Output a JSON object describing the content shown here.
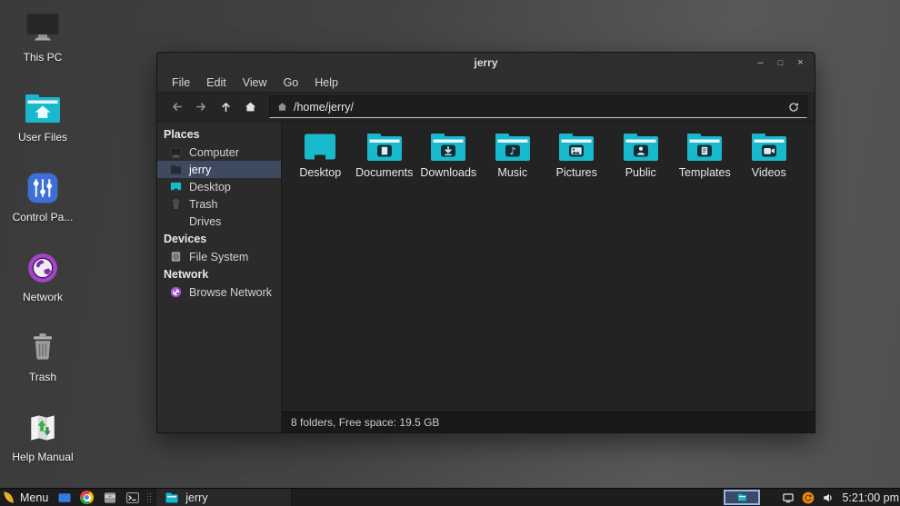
{
  "desktop": {
    "icons": [
      {
        "label": "This PC",
        "icon": "this-pc"
      },
      {
        "label": "User Files",
        "icon": "user-files"
      },
      {
        "label": "Control Pa...",
        "icon": "control-panel"
      },
      {
        "label": "Network",
        "icon": "network"
      },
      {
        "label": "Trash",
        "icon": "trash"
      },
      {
        "label": "Help Manual",
        "icon": "help-manual"
      }
    ]
  },
  "window": {
    "title": "jerry",
    "controls": {
      "minimize": "–",
      "maximize": "□",
      "close": "×"
    },
    "menu": [
      {
        "label": "File"
      },
      {
        "label": "Edit"
      },
      {
        "label": "View"
      },
      {
        "label": "Go"
      },
      {
        "label": "Help"
      }
    ],
    "toolbar": {
      "path": "/home/jerry/"
    },
    "sidebar": {
      "sections": [
        {
          "header": "Places",
          "items": [
            {
              "label": "Computer",
              "icon": "computer",
              "selected": false
            },
            {
              "label": "jerry",
              "icon": "home-dir",
              "selected": true
            },
            {
              "label": "Desktop",
              "icon": "desktop-small",
              "selected": false
            },
            {
              "label": "Trash",
              "icon": "trash-small",
              "selected": false
            },
            {
              "label": "Drives",
              "icon": "drives",
              "selected": false
            }
          ]
        },
        {
          "header": "Devices",
          "items": [
            {
              "label": "File System",
              "icon": "filesystem",
              "selected": false
            }
          ]
        },
        {
          "header": "Network",
          "items": [
            {
              "label": "Browse Network",
              "icon": "network-small",
              "selected": false
            }
          ]
        }
      ]
    },
    "files": [
      {
        "label": "Desktop",
        "icon": "desktop-screen"
      },
      {
        "label": "Documents",
        "icon": "folder-document"
      },
      {
        "label": "Downloads",
        "icon": "folder-download"
      },
      {
        "label": "Music",
        "icon": "folder-music"
      },
      {
        "label": "Pictures",
        "icon": "folder-picture"
      },
      {
        "label": "Public",
        "icon": "folder-person"
      },
      {
        "label": "Templates",
        "icon": "folder-template"
      },
      {
        "label": "Videos",
        "icon": "folder-video"
      }
    ],
    "statusbar": "8 folders, Free space: 19.5 GB"
  },
  "taskbar": {
    "menu_label": "Menu",
    "launchers": [
      {
        "icon": "show-desktop"
      },
      {
        "icon": "chrome"
      },
      {
        "icon": "archive"
      },
      {
        "icon": "terminal"
      }
    ],
    "task": {
      "label": "jerry",
      "icon": "task-folder"
    },
    "tray": [
      {
        "icon": "tray-display"
      },
      {
        "icon": "tray-update"
      },
      {
        "icon": "tray-volume"
      }
    ],
    "clock": "5:21:00 pm"
  },
  "colors": {
    "folder_cyan": "#19b9cd",
    "selection_bg": "#3e4a5f",
    "control_blue": "#3e6ed8",
    "network_purple": "#a245c6",
    "update_orange": "#ef8f1c"
  }
}
